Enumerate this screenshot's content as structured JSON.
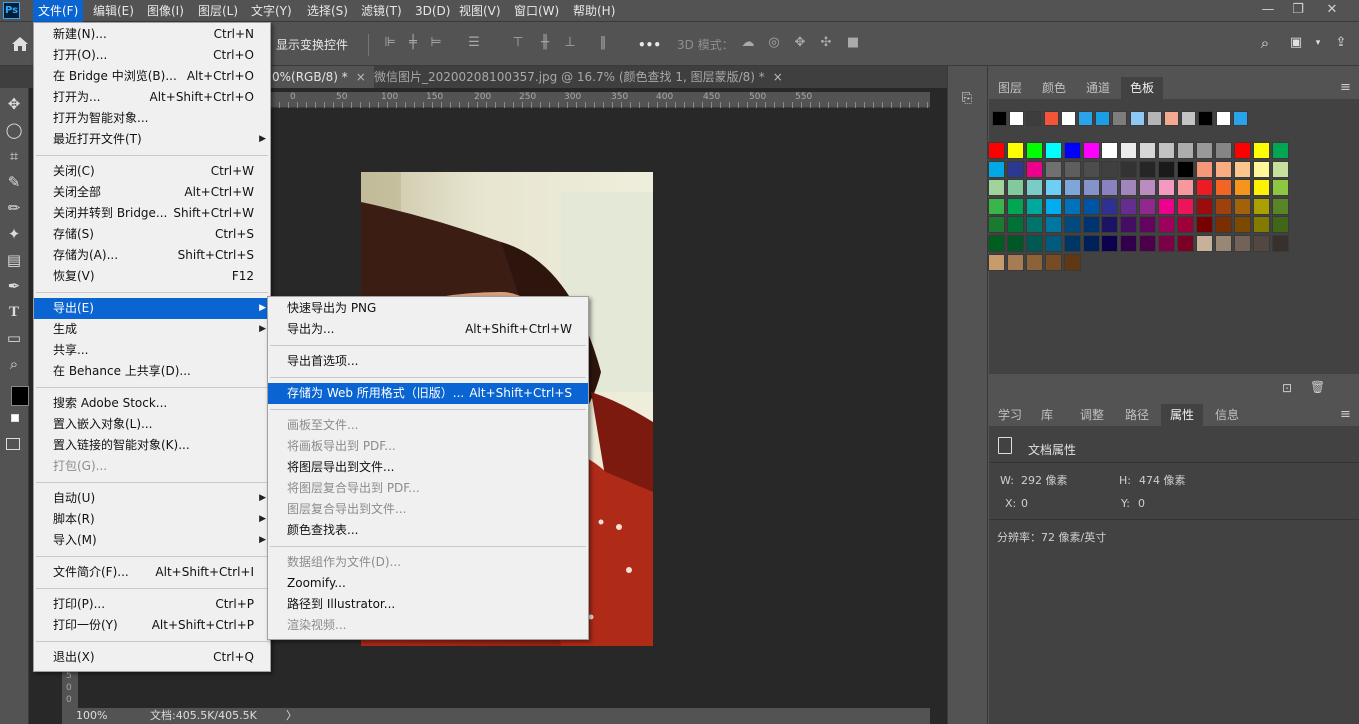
{
  "menubar": {
    "logo": "Ps",
    "items": [
      "文件(F)",
      "编辑(E)",
      "图像(I)",
      "图层(L)",
      "文字(Y)",
      "选择(S)",
      "滤镜(T)",
      "3D(D)",
      "视图(V)",
      "窗口(W)",
      "帮助(H)"
    ],
    "win_min": "—",
    "win_restore": "❐",
    "win_close": "✕"
  },
  "optionsbar": {
    "show_transform": "显示变换控件",
    "more": "•••",
    "mode_3d": "3D 模式："
  },
  "tabs": [
    {
      "label": "0%(RGB/8) *",
      "active": true
    },
    {
      "label": "微信图片_20200208100357.jpg @ 16.7% (颜色查找 1, 图层蒙版/8) *",
      "active": false
    }
  ],
  "tab_close": "×",
  "ruler": {
    "labels": [
      "0",
      "50",
      "100",
      "150",
      "200",
      "250",
      "300",
      "350",
      "400",
      "450",
      "500",
      "550"
    ]
  },
  "vruler_labels": [
    "5",
    "0",
    "0"
  ],
  "status": {
    "zoom": "100%",
    "doc": "文档:405.5K/405.5K",
    "arrow": "〉"
  },
  "file_menu": {
    "groups": [
      [
        {
          "label": "新建(N)...",
          "shortcut": "Ctrl+N"
        },
        {
          "label": "打开(O)...",
          "shortcut": "Ctrl+O"
        },
        {
          "label": "在 Bridge 中浏览(B)...",
          "shortcut": "Alt+Ctrl+O"
        },
        {
          "label": "打开为...",
          "shortcut": "Alt+Shift+Ctrl+O"
        },
        {
          "label": "打开为智能对象...",
          "shortcut": ""
        },
        {
          "label": "最近打开文件(T)",
          "shortcut": "",
          "submenu": true
        }
      ],
      [
        {
          "label": "关闭(C)",
          "shortcut": "Ctrl+W"
        },
        {
          "label": "关闭全部",
          "shortcut": "Alt+Ctrl+W"
        },
        {
          "label": "关闭并转到 Bridge...",
          "shortcut": "Shift+Ctrl+W"
        },
        {
          "label": "存储(S)",
          "shortcut": "Ctrl+S"
        },
        {
          "label": "存储为(A)...",
          "shortcut": "Shift+Ctrl+S"
        },
        {
          "label": "恢复(V)",
          "shortcut": "F12"
        }
      ],
      [
        {
          "label": "导出(E)",
          "shortcut": "",
          "submenu": true,
          "highlighted": true
        },
        {
          "label": "生成",
          "shortcut": "",
          "submenu": true
        },
        {
          "label": "共享...",
          "shortcut": ""
        },
        {
          "label": "在 Behance 上共享(D)...",
          "shortcut": ""
        }
      ],
      [
        {
          "label": "搜索 Adobe Stock...",
          "shortcut": ""
        },
        {
          "label": "置入嵌入对象(L)...",
          "shortcut": ""
        },
        {
          "label": "置入链接的智能对象(K)...",
          "shortcut": ""
        },
        {
          "label": "打包(G)...",
          "shortcut": "",
          "disabled": true
        }
      ],
      [
        {
          "label": "自动(U)",
          "shortcut": "",
          "submenu": true
        },
        {
          "label": "脚本(R)",
          "shortcut": "",
          "submenu": true
        },
        {
          "label": "导入(M)",
          "shortcut": "",
          "submenu": true
        }
      ],
      [
        {
          "label": "文件简介(F)...",
          "shortcut": "Alt+Shift+Ctrl+I"
        }
      ],
      [
        {
          "label": "打印(P)...",
          "shortcut": "Ctrl+P"
        },
        {
          "label": "打印一份(Y)",
          "shortcut": "Alt+Shift+Ctrl+P"
        }
      ],
      [
        {
          "label": "退出(X)",
          "shortcut": "Ctrl+Q"
        }
      ]
    ]
  },
  "export_menu": {
    "groups": [
      [
        {
          "label": "快速导出为 PNG",
          "shortcut": ""
        },
        {
          "label": "导出为...",
          "shortcut": "Alt+Shift+Ctrl+W"
        }
      ],
      [
        {
          "label": "导出首选项...",
          "shortcut": ""
        }
      ],
      [
        {
          "label": "存储为 Web 所用格式（旧版）...",
          "shortcut": "Alt+Shift+Ctrl+S",
          "highlighted": true
        }
      ],
      [
        {
          "label": "画板至文件...",
          "shortcut": "",
          "disabled": true
        },
        {
          "label": "将画板导出到 PDF...",
          "shortcut": "",
          "disabled": true
        },
        {
          "label": "将图层导出到文件...",
          "shortcut": ""
        },
        {
          "label": "将图层复合导出到 PDF...",
          "shortcut": "",
          "disabled": true
        },
        {
          "label": "图层复合导出到文件...",
          "shortcut": "",
          "disabled": true
        },
        {
          "label": "颜色查找表...",
          "shortcut": ""
        }
      ],
      [
        {
          "label": "数据组作为文件(D)...",
          "shortcut": "",
          "disabled": true
        },
        {
          "label": "Zoomify...",
          "shortcut": ""
        },
        {
          "label": "路径到 Illustrator...",
          "shortcut": ""
        },
        {
          "label": "渲染视频...",
          "shortcut": "",
          "disabled": true
        }
      ]
    ]
  },
  "panel_top": {
    "tabs": [
      "图层",
      "颜色",
      "通道",
      "色板"
    ],
    "active": "色板",
    "recent_swatches": [
      "#000000",
      "#ffffff",
      "#3d3d3d",
      "#f4553a",
      "#ffffff",
      "#29a3ea",
      "#1a9fe6",
      "#7d7d7d",
      "#8ec8f5",
      "#b5b5b5",
      "#f5a990",
      "#c4c4c4",
      "#000000",
      "#ffffff",
      "#29a3ea"
    ],
    "swatches": [
      [
        "#ff0000",
        "#ffff00",
        "#00ff00",
        "#00ffff",
        "#0000ff",
        "#ff00ff",
        "#ffffff",
        "#ebebeb",
        "#d6d6d6",
        "#c2c2c2",
        "#adadad",
        "#999999",
        "#858585",
        "#ff0000",
        "#ffff00",
        "#00a651"
      ],
      [
        "#00a9e6",
        "#2b3990",
        "#ec008c",
        "#707070",
        "#5e5e5e",
        "#4d4d4d",
        "#404040",
        "#333333",
        "#262626",
        "#1a1a1a",
        "#000000",
        "#f7977a",
        "#fbad82",
        "#fdc68c",
        "#fff799",
        "#c6df9c"
      ],
      [
        "#a3d39c",
        "#82ca9c",
        "#7accc8",
        "#6dcff6",
        "#7da7d8",
        "#8493ca",
        "#8882be",
        "#a186be",
        "#bc8cbf",
        "#f49ac1",
        "#f6989d",
        "#ed1c24",
        "#f26522",
        "#f7941d",
        "#fff200",
        "#8dc63f"
      ],
      [
        "#39b54a",
        "#00a651",
        "#00a99d",
        "#00aeef",
        "#0072bc",
        "#0054a6",
        "#2e3192",
        "#662d91",
        "#92278f",
        "#ec008c",
        "#ed145b",
        "#9e0b0f",
        "#a0410d",
        "#a36209",
        "#aba000",
        "#598527"
      ],
      [
        "#1a7b30",
        "#007236",
        "#00746b",
        "#0076a3",
        "#004a80",
        "#003471",
        "#1b1464",
        "#440e62",
        "#630460",
        "#9e005d",
        "#9e0039",
        "#790000",
        "#7b2e00",
        "#7d4900",
        "#827b00",
        "#406618"
      ],
      [
        "#005e20",
        "#005826",
        "#005952",
        "#005b7f",
        "#003663",
        "#002157",
        "#0d004c",
        "#32004b",
        "#4b0049",
        "#7b0046",
        "#7a0026",
        "#c7b299",
        "#998675",
        "#736357",
        "#534741",
        "#37302d"
      ],
      [
        "#c69c6d",
        "#a67c52",
        "#8c6239",
        "#754c24",
        "#603913"
      ]
    ]
  },
  "panel_bottom": {
    "tabs": [
      "学习",
      "库",
      "调整",
      "路径",
      "属性",
      "信息"
    ],
    "active": "属性",
    "title": "文档属性",
    "w_label": "W:",
    "w_value": "292 像素",
    "h_label": "H:",
    "h_value": "474 像素",
    "x_label": "X:",
    "x_value": "0",
    "y_label": "Y:",
    "y_value": "0",
    "resolution": "分辨率：72 像素/英寸"
  }
}
